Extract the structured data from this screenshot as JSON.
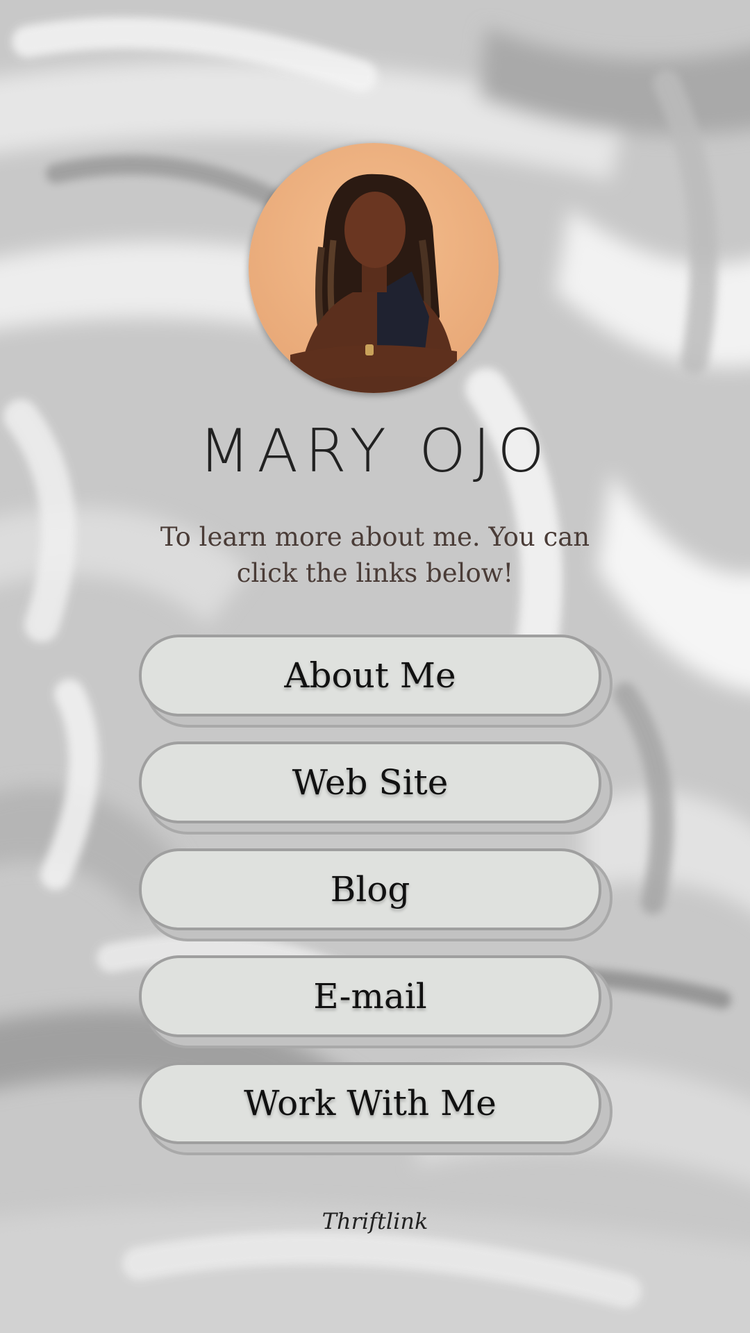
{
  "profile": {
    "name": "MARY OJO",
    "bio": "To learn more about me. You can click the links below!"
  },
  "links": [
    {
      "label": "About Me"
    },
    {
      "label": "Web Site"
    },
    {
      "label": "Blog"
    },
    {
      "label": "E-mail"
    },
    {
      "label": "Work With Me"
    }
  ],
  "footer": {
    "brand": "Thriftlink"
  },
  "colors": {
    "background": "#c9c9c9",
    "button_fill": "#dfe1de",
    "button_border": "#9f9f9f",
    "avatar_backdrop": "#f0b584",
    "name_text": "#222222",
    "bio_text": "#4a3c37"
  },
  "icons": {
    "avatar": "profile-photo"
  }
}
